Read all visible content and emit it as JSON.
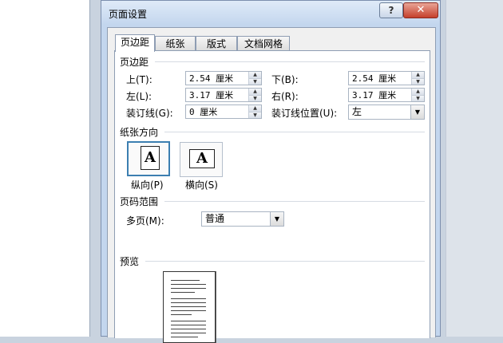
{
  "dialog": {
    "title": "页面设置",
    "help_label": "?",
    "close_label": "✕"
  },
  "tabs": [
    {
      "label": "页边距",
      "active": true
    },
    {
      "label": "纸张"
    },
    {
      "label": "版式"
    },
    {
      "label": "文档网格"
    }
  ],
  "margins": {
    "section_title": "页边距",
    "top": {
      "label": "上(T):",
      "value": "2.54 厘米"
    },
    "bottom": {
      "label": "下(B):",
      "value": "2.54 厘米"
    },
    "left": {
      "label": "左(L):",
      "value": "3.17 厘米"
    },
    "right": {
      "label": "右(R):",
      "value": "3.17 厘米"
    },
    "gutter": {
      "label": "装订线(G):",
      "value": "0 厘米"
    },
    "gutter_position": {
      "label": "装订线位置(U):",
      "value": "左"
    }
  },
  "orientation": {
    "section_title": "纸张方向",
    "portrait_label": "纵向(P)",
    "landscape_label": "横向(S)",
    "glyph": "A",
    "selected": "portrait"
  },
  "pages": {
    "section_title": "页码范围",
    "multiple_label": "多页(M):",
    "multiple_value": "普通"
  },
  "preview": {
    "section_title": "预览"
  },
  "colors": {
    "dialog_frame": "#c3d6ee",
    "selected_border": "#3c7fb1",
    "close_button": "#c5402c"
  }
}
